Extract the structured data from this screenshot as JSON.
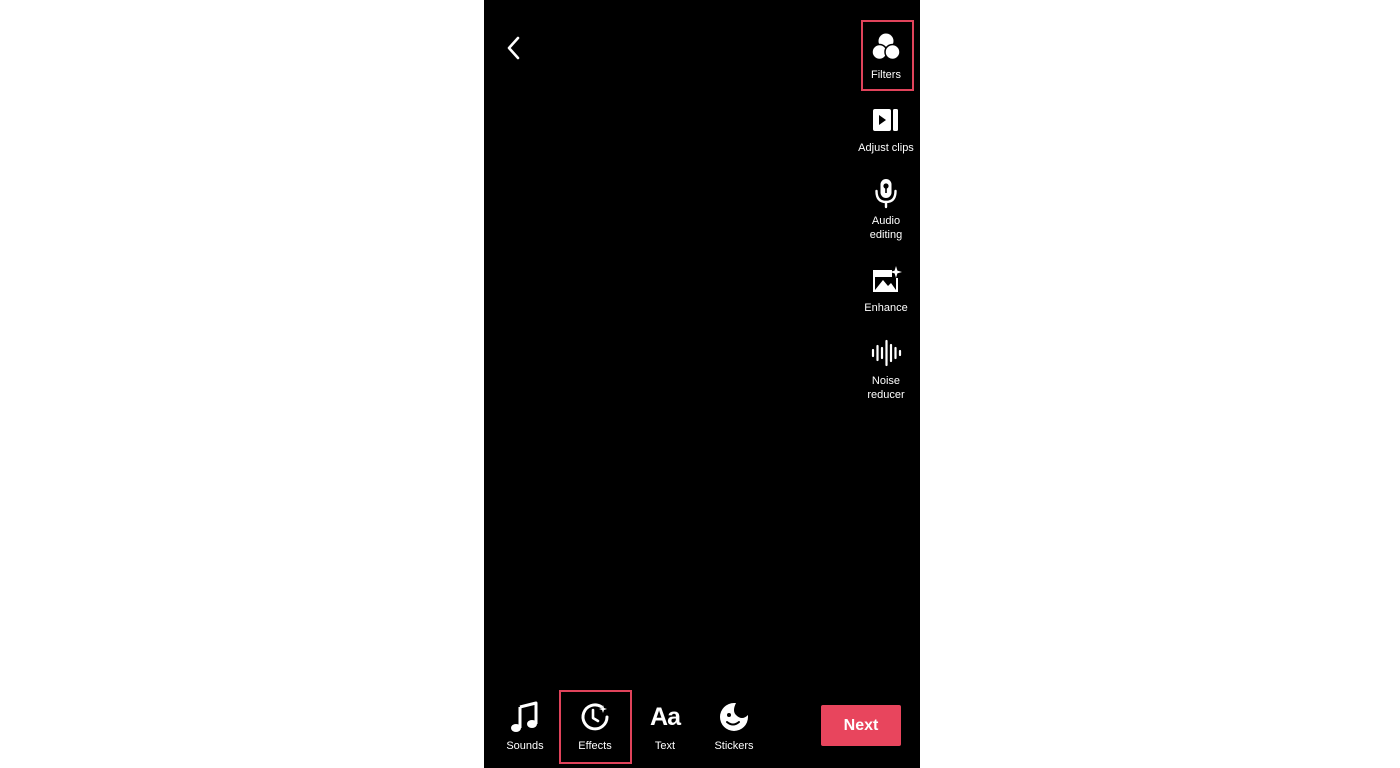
{
  "side_toolbar": {
    "filters": {
      "label": "Filters",
      "icon": "filters-icon"
    },
    "adjust_clips": {
      "label": "Adjust clips",
      "icon": "adjust-clips-icon"
    },
    "audio_editing": {
      "label": "Audio\nediting",
      "icon": "microphone-icon"
    },
    "enhance": {
      "label": "Enhance",
      "icon": "enhance-icon"
    },
    "noise_reducer": {
      "label": "Noise\nreducer",
      "icon": "noise-reducer-icon"
    }
  },
  "bottom_toolbar": {
    "sounds": {
      "label": "Sounds",
      "icon": "music-note-icon"
    },
    "effects": {
      "label": "Effects",
      "icon": "effects-icon"
    },
    "text": {
      "label": "Text",
      "glyph": "Aa",
      "icon": "text-icon"
    },
    "stickers": {
      "label": "Stickers",
      "icon": "sticker-icon"
    }
  },
  "next_button": {
    "label": "Next"
  },
  "colors": {
    "background": "#000000",
    "accent": "#e8455d",
    "highlight_border": "#e0435b",
    "icon": "#ffffff"
  }
}
